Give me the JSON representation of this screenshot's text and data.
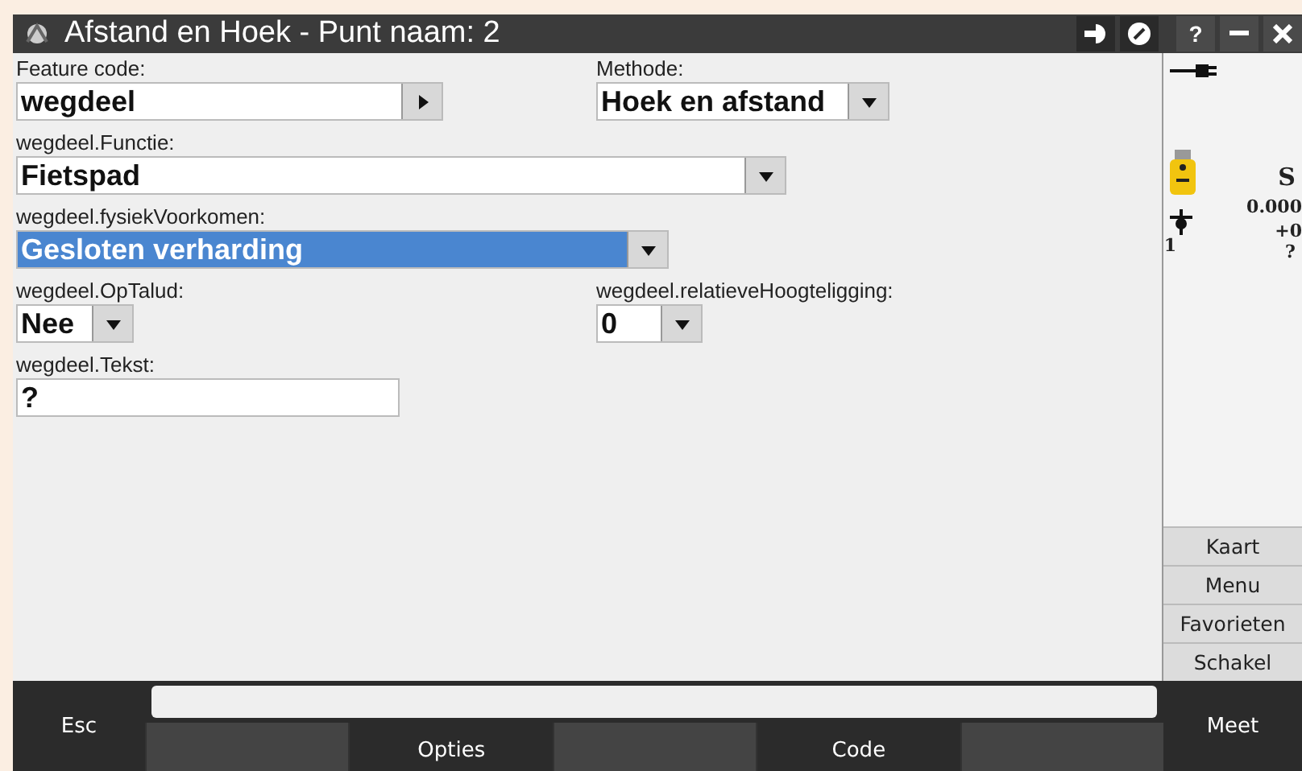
{
  "window": {
    "title": "Afstand en Hoek - Punt naam: 2",
    "help": "?"
  },
  "rows": [
    [
      {
        "label": "Feature code:",
        "kind": "picker",
        "value": "wegdeel",
        "focused": false
      },
      {
        "label": "Methode:",
        "kind": "dropdown",
        "value": "Hoek en afstand",
        "focused": false
      }
    ],
    [
      {
        "label": "wegdeel.Functie:",
        "kind": "dropdown",
        "value": "Fietspad",
        "focused": false
      }
    ],
    [
      {
        "label": "wegdeel.fysiekVoorkomen:",
        "kind": "dropdown",
        "value": "Gesloten verharding",
        "focused": true
      }
    ],
    [
      {
        "label": "wegdeel.OpTalud:",
        "kind": "dropdown",
        "value": "Nee",
        "focused": false
      },
      {
        "label": "wegdeel.relatieveHoogteligging:",
        "kind": "dropdown",
        "value": "0",
        "focused": false
      }
    ],
    [
      {
        "label": "wegdeel.Tekst:",
        "kind": "text",
        "value": "?",
        "focused": false
      }
    ]
  ],
  "status": {
    "instrument": "S",
    "reading": "0.000",
    "prism_offset": "+0",
    "prism_number": "1",
    "prism_value": "?"
  },
  "side_buttons": [
    "Kaart",
    "Menu",
    "Favorieten",
    "Schakel"
  ],
  "bottom": {
    "esc": "Esc",
    "softkeys": [
      {
        "kind": "blank"
      },
      {
        "kind": "label",
        "label": "Opties"
      },
      {
        "kind": "blank"
      },
      {
        "kind": "label",
        "label": "Code"
      },
      {
        "kind": "blank"
      }
    ],
    "meet": "Meet"
  }
}
